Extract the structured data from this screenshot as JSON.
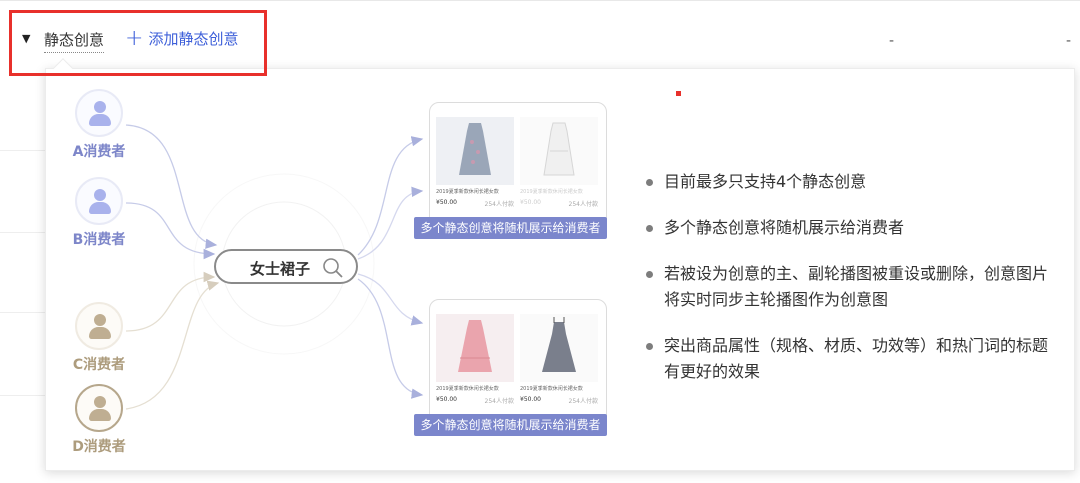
{
  "header": {
    "section_label": "静态创意",
    "add_link_label": "添加静态创意",
    "dash_1": "-",
    "dash_2": "-"
  },
  "diagram": {
    "consumers": [
      {
        "label": "A消费者"
      },
      {
        "label": "B消费者"
      },
      {
        "label": "C消费者"
      },
      {
        "label": "D消费者"
      }
    ],
    "search_keyword": "女士裙子",
    "cards": [
      {
        "banner": "多个静态创意将随机展示给消费者",
        "products": [
          {
            "title": "2019夏季新款休闲长裙女款",
            "price": "¥50.00",
            "sales": "254人付款"
          },
          {
            "title": "2019夏季新款休闲长裙女款",
            "price": "¥50.00",
            "sales": "254人付款"
          }
        ]
      },
      {
        "banner": "多个静态创意将随机展示给消费者",
        "products": [
          {
            "title": "2019夏季新款休闲长裙女款",
            "price": "¥50.00",
            "sales": "254人付款"
          },
          {
            "title": "2019夏季新款休闲长裙女款",
            "price": "¥50.00",
            "sales": "254人付款"
          }
        ]
      }
    ]
  },
  "tips": [
    "目前最多只支持4个静态创意",
    "多个静态创意将随机展示给消费者",
    "若被设为创意的主、副轮播图被重设或删除，创意图片将实时同步主轮播图作为创意图",
    "突出商品属性（规格、材质、功效等）和热门词的标题有更好的效果"
  ],
  "colors": {
    "highlight_box": "#e8302b",
    "link": "#3d5fd9",
    "banner": "#7b86cc",
    "consumer_blue": "#7d86c9",
    "consumer_tan": "#ad9c7d"
  }
}
